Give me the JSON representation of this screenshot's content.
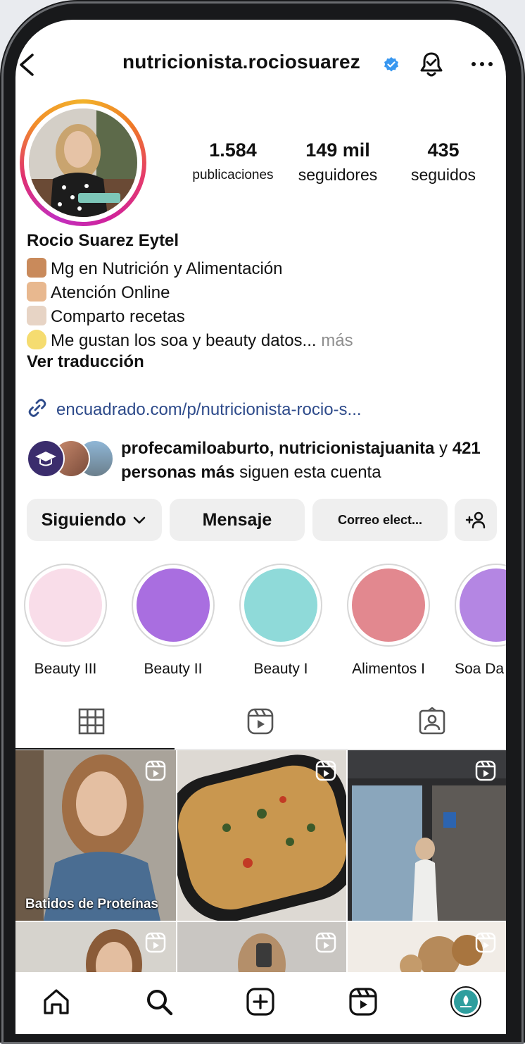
{
  "header": {
    "username": "nutricionista.rociosuarez",
    "verified": true,
    "icons": [
      "back-arrow-icon",
      "verified-badge-icon",
      "notification-bell-icon",
      "more-options-icon"
    ]
  },
  "stats": {
    "posts": {
      "value": "1.584",
      "label": "publicaciones"
    },
    "followers": {
      "value": "149 mil",
      "label": "seguidores"
    },
    "following": {
      "value": "435",
      "label": "seguidos"
    }
  },
  "bio": {
    "name": "Rocio Suarez Eytel",
    "lines": [
      {
        "emoji": "graduate-emoji",
        "text": "Mg en Nutrición y Alimentación"
      },
      {
        "emoji": "laptop-emoji",
        "text": "Atención Online"
      },
      {
        "emoji": "chef-emoji",
        "text": "Comparto recetas"
      },
      {
        "emoji": "lightbulb-emoji",
        "text": "Me gustan los soa y beauty datos...",
        "more": "más"
      }
    ],
    "translate": "Ver traducción",
    "link": "encuadrado.com/p/nutricionista-rocio-s..."
  },
  "followed_by": {
    "names": "profecamiloaburto, nutricionistajuanita",
    "connector": " y ",
    "count_text": "421 personas más",
    "suffix": " siguen esta cuenta"
  },
  "actions": {
    "following": "Siguiendo",
    "message": "Mensaje",
    "email": "Correo elect...",
    "add_person": "+"
  },
  "highlights": [
    {
      "label": "Beauty III",
      "color": "#f9dde9"
    },
    {
      "label": "Beauty II",
      "color": "#a96ee0"
    },
    {
      "label": "Beauty I",
      "color": "#8fdad9"
    },
    {
      "label": "Alimentos I",
      "color": "#e2888f"
    },
    {
      "label": "Soa Da",
      "color": "#b486e3"
    }
  ],
  "tabs": [
    "grid-icon",
    "reels-icon",
    "tagged-icon"
  ],
  "posts": [
    {
      "caption": "Batidos de Proteínas",
      "type": "reel"
    },
    {
      "caption": "",
      "type": "reel"
    },
    {
      "caption": "",
      "type": "reel"
    },
    {
      "caption": "",
      "type": "reel"
    },
    {
      "caption": "",
      "type": "reel"
    },
    {
      "caption": "",
      "type": "reel"
    }
  ],
  "bottom_nav": [
    "home-icon",
    "search-icon",
    "create-icon",
    "reels-nav-icon",
    "profile-avatar-icon"
  ],
  "colors": {
    "link": "#2d4a8a",
    "verified": "#3897f0",
    "button_bg": "#efefef",
    "muted": "#8e8e8e"
  }
}
